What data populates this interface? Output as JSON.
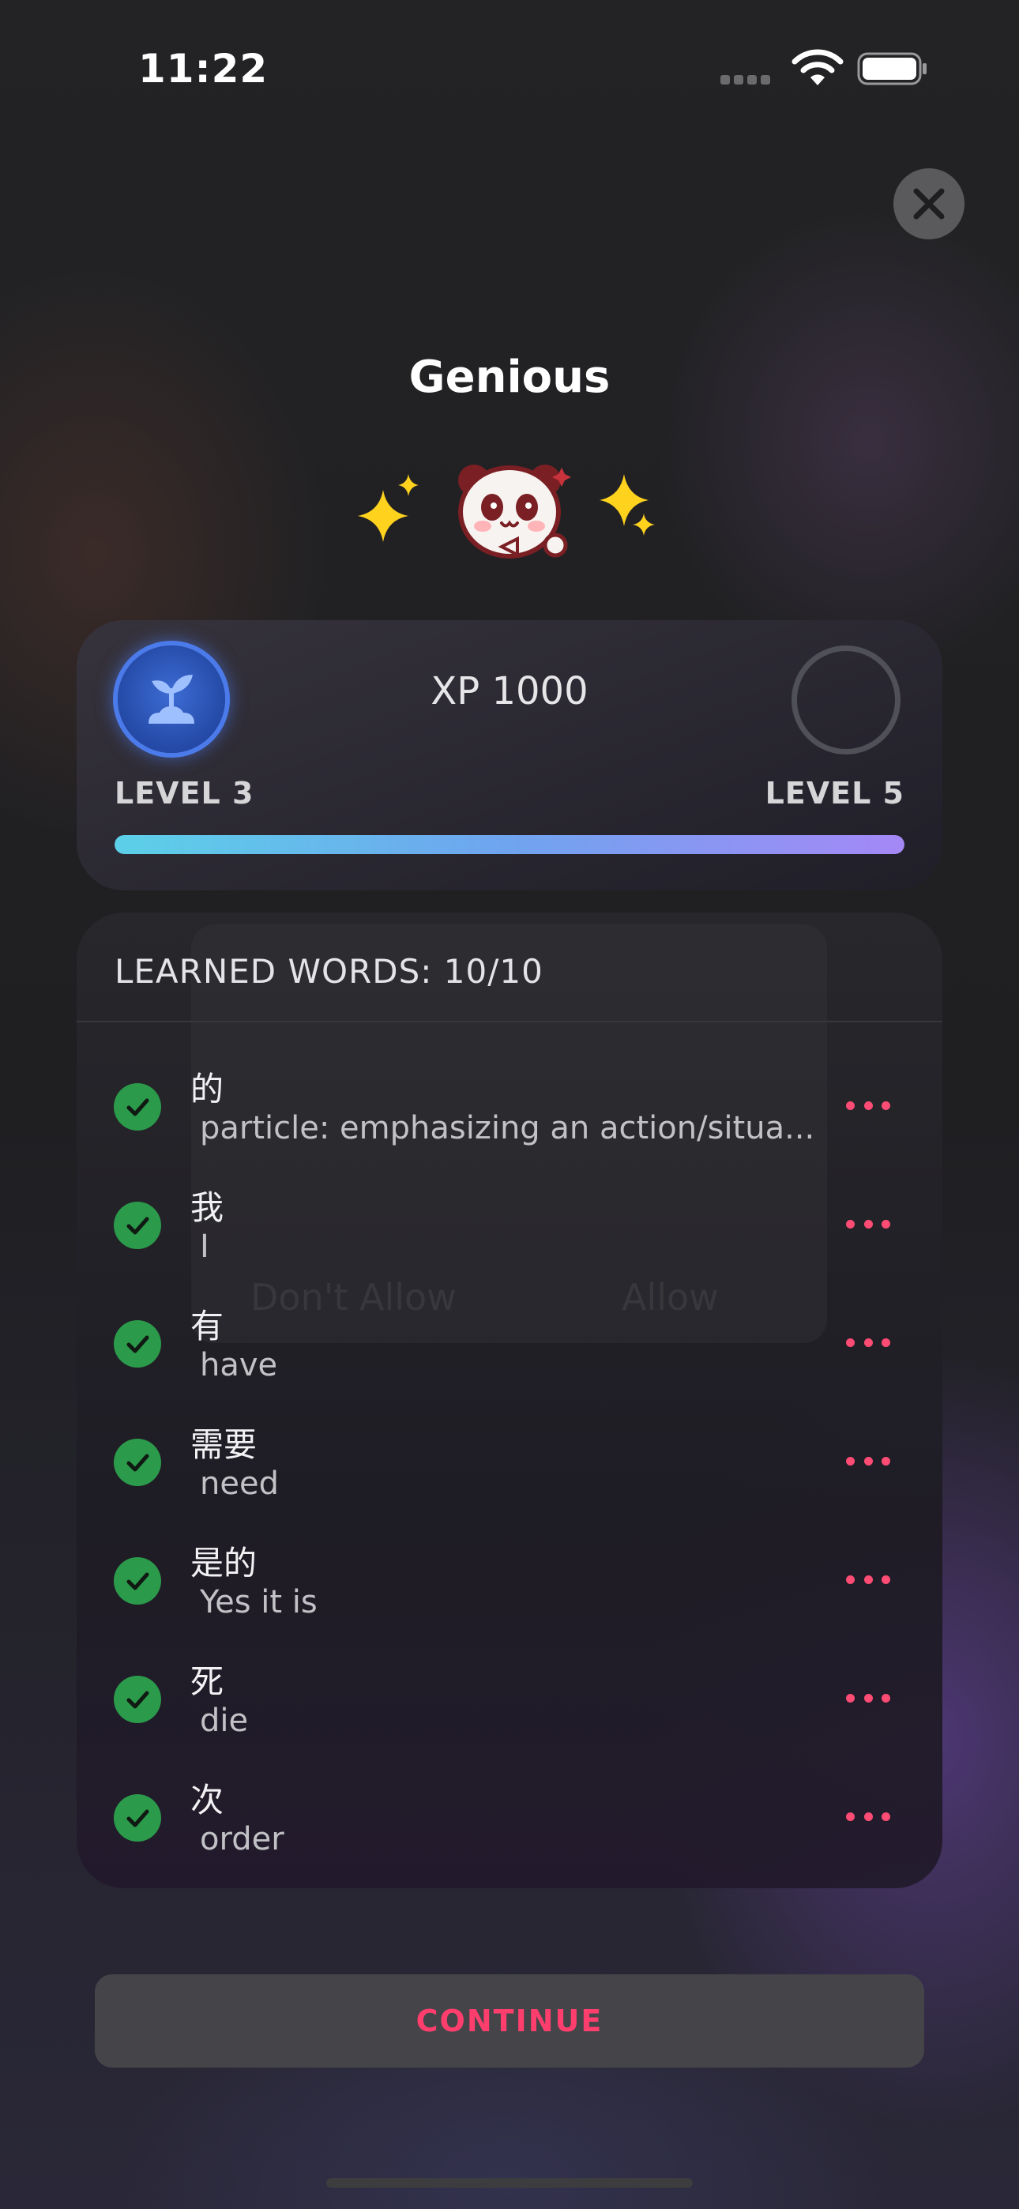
{
  "status_bar": {
    "time": "11:22",
    "icons": [
      "cellular-signal-icon",
      "wifi-icon",
      "battery-icon"
    ]
  },
  "close_icon": "close-icon",
  "title": "Genious",
  "mascot": {
    "left_icon": "sparkles-icon",
    "center_icon": "panda-mascot-icon",
    "right_icon": "sparkles-icon"
  },
  "level_card": {
    "xp_label": "XP 1000",
    "current_level": "LEVEL 3",
    "next_level": "LEVEL 5",
    "current_badge_icon": "sprout-icon",
    "progress_fraction": 1.0,
    "colors": {
      "progress_start": "#5cd0e8",
      "progress_end": "#a488f6",
      "badge": "#3d6cd4"
    }
  },
  "words_card": {
    "header": "LEARNED WORDS: 10/10",
    "ghost_dialog": {
      "buttons": [
        "Don't Allow",
        "Allow"
      ]
    },
    "words": [
      {
        "hanzi": "的",
        "meaning": "particle: emphasizing an action/situa..."
      },
      {
        "hanzi": "我",
        "meaning": "I"
      },
      {
        "hanzi": "有",
        "meaning": "have"
      },
      {
        "hanzi": "需要",
        "meaning": "need"
      },
      {
        "hanzi": "是的",
        "meaning": "Yes it is"
      },
      {
        "hanzi": "死",
        "meaning": "die"
      },
      {
        "hanzi": "次",
        "meaning": "order"
      }
    ],
    "colors": {
      "check": "#2b9a4b",
      "more_dots": "#ff4c74"
    }
  },
  "continue_button": {
    "label": "CONTINUE",
    "color": "#ff3e6e"
  }
}
